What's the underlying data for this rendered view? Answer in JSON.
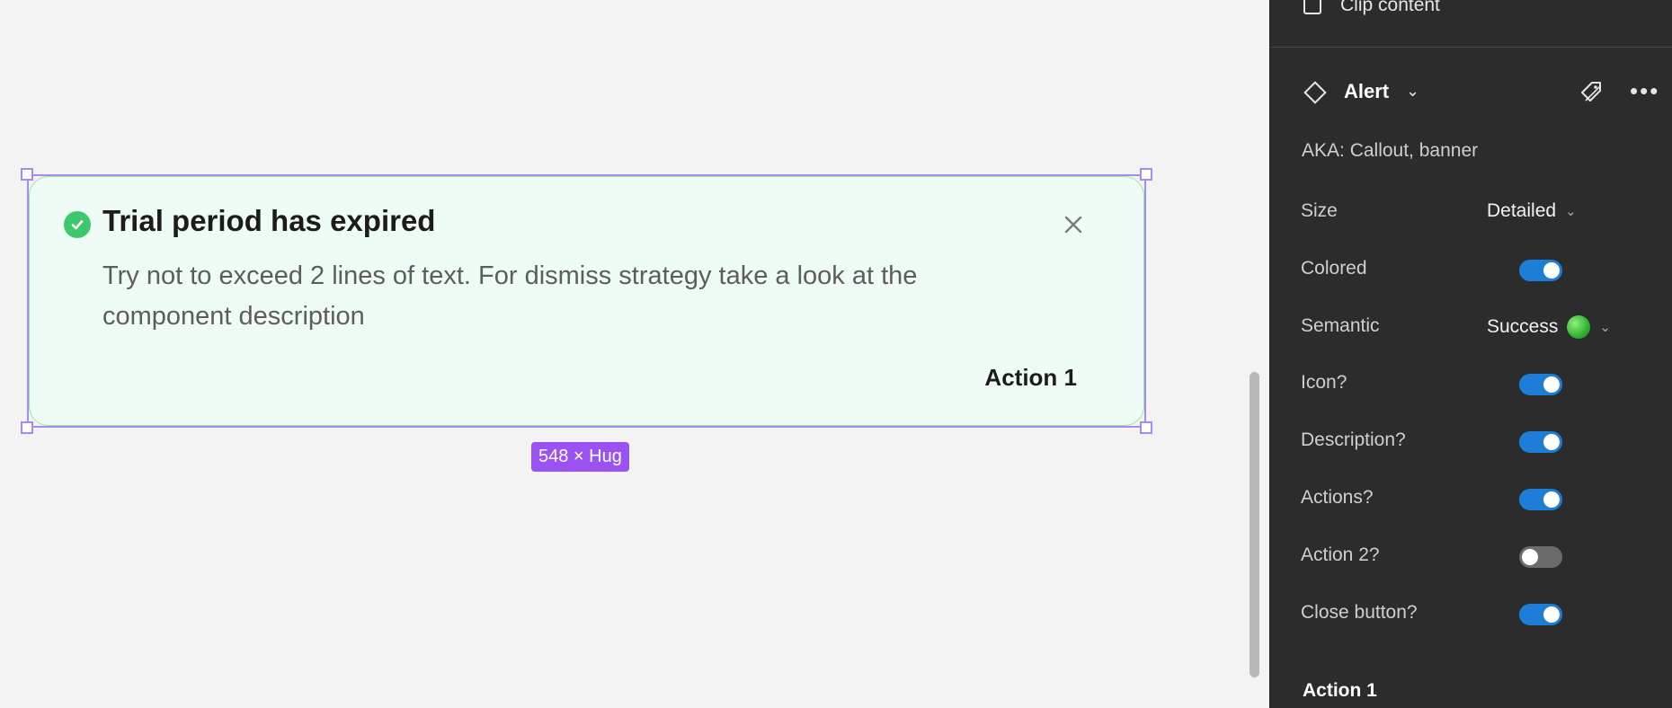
{
  "alert": {
    "title": "Trial period has expired",
    "description": "Try not to exceed 2 lines of text. For dismiss strategy take a look at the component description",
    "action_label": "Action 1",
    "size_badge": "548 × Hug",
    "accent_color": "#3dc86d",
    "background_color": "#effcf5",
    "selection_color": "#a58bf2"
  },
  "panel": {
    "clip_content_label": "Clip content",
    "clip_content_checked": false,
    "component_name": "Alert",
    "aka_text": "AKA: Callout, banner",
    "properties": {
      "size": {
        "label": "Size",
        "value": "Detailed"
      },
      "colored": {
        "label": "Colored",
        "on": true
      },
      "semantic": {
        "label": "Semantic",
        "value": "Success",
        "indicator_color": "#3cb33c"
      },
      "icon": {
        "label": "Icon?",
        "on": true
      },
      "description": {
        "label": "Description?",
        "on": true
      },
      "actions": {
        "label": "Actions?",
        "on": true
      },
      "action2": {
        "label": "Action 2?",
        "on": false
      },
      "close_button": {
        "label": "Close button?",
        "on": true
      }
    },
    "section_title": "Action 1",
    "toggle_on_color": "#1c7ed6"
  }
}
